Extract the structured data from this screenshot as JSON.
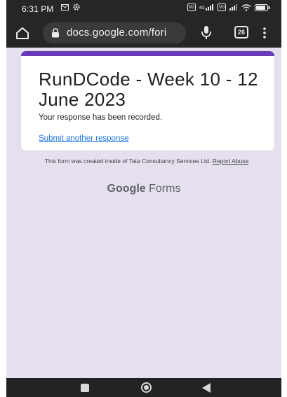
{
  "status_bar": {
    "time": "6:31 PM",
    "icons": [
      "mail-icon",
      "settings-gear-icon",
      "volte-icon",
      "signal-4g-icon",
      "signal-icon",
      "wifi-icon",
      "battery-icon"
    ],
    "lte_label": "4G"
  },
  "browser": {
    "url": "docs.google.com/fori",
    "tab_count": "26",
    "icons": [
      "home-icon",
      "lock-icon",
      "mic-icon",
      "tab-switcher-icon",
      "more-menu-icon"
    ]
  },
  "form": {
    "title": "RunDCode - Week 10 - 12 June 2023",
    "message": "Your response has been recorded.",
    "another_link": "Submit another response",
    "accent_color": "#673ab7"
  },
  "footer": {
    "created_text": "This form was created inside of Tata Consultancy Services Ltd.",
    "report_link": "Report Abuse",
    "logo_google": "Google",
    "logo_forms": "Forms"
  },
  "nav": {
    "icons": [
      "recents-icon",
      "home-circle-icon",
      "back-triangle-icon"
    ]
  }
}
